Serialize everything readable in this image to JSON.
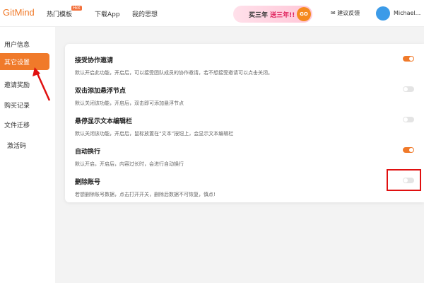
{
  "header": {
    "logo": "GitMind",
    "nav": [
      "热门模板",
      "下载App",
      "我的思想"
    ],
    "hot_badge": "Hot",
    "banner": {
      "prefix": "买三年",
      "text": "送三年!!",
      "go": "GO"
    },
    "feedback": "建议反馈",
    "user": "Michael..."
  },
  "sidebar": {
    "items": [
      {
        "label": "用户信息"
      },
      {
        "label": "其它设置",
        "active": true
      },
      {
        "label": "邀请奖励"
      },
      {
        "label": "购买记录"
      },
      {
        "label": "文件迁移"
      },
      {
        "label": "激活码"
      }
    ]
  },
  "settings": [
    {
      "title": "接受协作邀请",
      "desc": "默认开启此功能，开启后，可以接受团队成员的协作邀请，若不想接受邀请可以点击关闭。",
      "on": true
    },
    {
      "title": "双击添加悬浮节点",
      "desc": "默认关闭该功能，开启后，双击即可添加悬浮节点",
      "on": false
    },
    {
      "title": "悬停显示文本编辑栏",
      "desc": "默认关闭该功能，开启后，鼠标放置在“文本”按钮上，会显示文本编辑栏",
      "on": false
    },
    {
      "title": "自动换行",
      "desc": "默认开启，开启后，内容过长时，会进行自动换行",
      "on": true
    },
    {
      "title": "删除账号",
      "desc": "若想删除账号数据，点击打开开关，删除后数据不可恢复，慎点!",
      "on": false
    }
  ],
  "colors": {
    "accent": "#f07a2a",
    "highlight": "#e01010"
  }
}
